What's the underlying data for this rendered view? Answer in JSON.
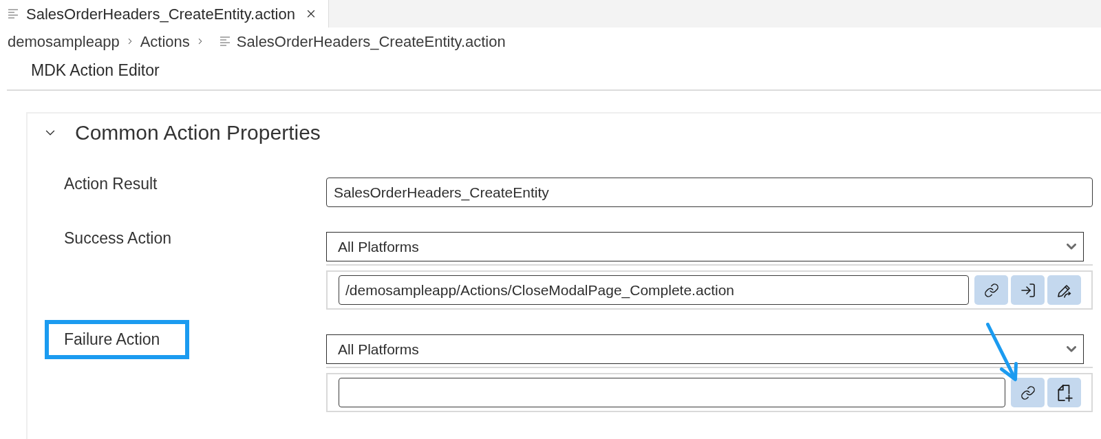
{
  "tabs": [
    {
      "label": "SalesOrderHeaders_CreateEntity.action",
      "selected": true
    }
  ],
  "breadcrumb": [
    {
      "label": "demosampleapp",
      "kind": "folder"
    },
    {
      "label": "Actions",
      "kind": "folder"
    },
    {
      "label": "SalesOrderHeaders_CreateEntity.action",
      "kind": "file"
    }
  ],
  "editor": {
    "title": "MDK Action Editor"
  },
  "section": {
    "title": "Common Action Properties",
    "expanded": true,
    "properties": [
      {
        "label": "Action Result",
        "highlighted": false,
        "kind": "text",
        "value": "SalesOrderHeaders_CreateEntity"
      },
      {
        "label": "Success Action",
        "highlighted": false,
        "kind": "action",
        "platform": "All Platforms",
        "value": "/demosampleapp/Actions/CloseModalPage_Complete.action",
        "buttons": [
          {
            "kind": "link",
            "annotated": false
          },
          {
            "kind": "import",
            "annotated": false
          },
          {
            "kind": "edit",
            "annotated": false
          }
        ]
      },
      {
        "label": "Failure Action",
        "highlighted": true,
        "kind": "action",
        "platform": "All Platforms",
        "buttons": [
          {
            "kind": "link",
            "annotated": true
          },
          {
            "kind": "new",
            "annotated": false
          }
        ]
      }
    ]
  }
}
